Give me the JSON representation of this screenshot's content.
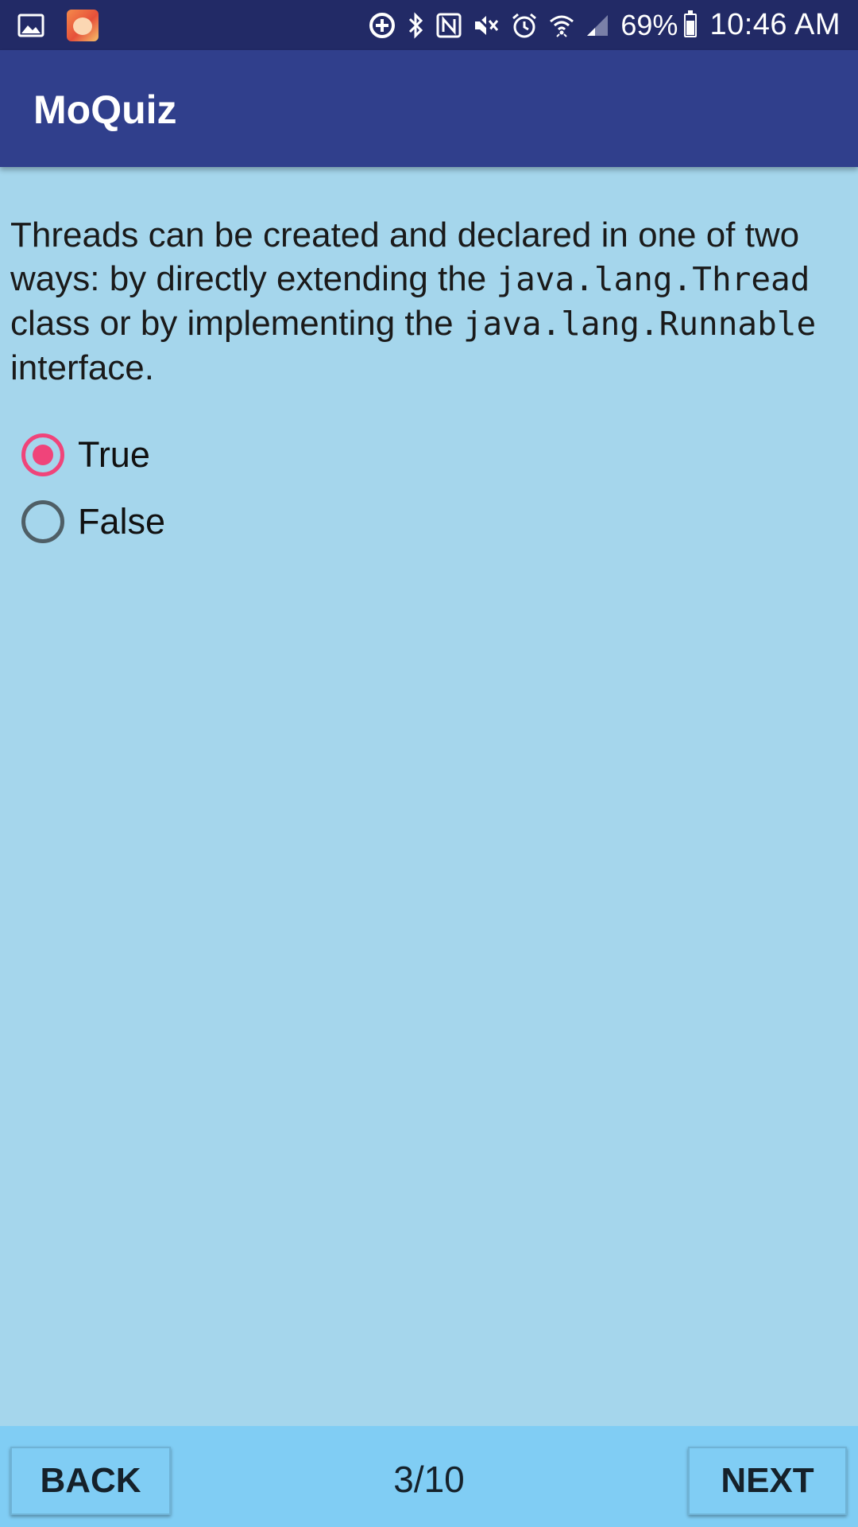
{
  "status_bar": {
    "battery": "69%",
    "time": "10:46 AM",
    "icons": [
      "gallery-icon",
      "app-thumbnail-icon",
      "data-saver-icon",
      "bluetooth-icon",
      "nfc-icon",
      "mute-icon",
      "alarm-icon",
      "wifi-icon",
      "signal-icon",
      "battery-icon"
    ]
  },
  "app_bar": {
    "title": "MoQuiz"
  },
  "question": {
    "part1": "Threads can be created and declared in one of two ways: by directly extending the ",
    "code1": "java.lang.Thread",
    "part2": " class or by implementing the ",
    "code2": "java.lang.Runnable",
    "part3": " interface."
  },
  "options": [
    {
      "label": "True",
      "selected": true
    },
    {
      "label": "False",
      "selected": false
    }
  ],
  "nav": {
    "back_label": "BACK",
    "next_label": "NEXT",
    "progress": "3/10"
  },
  "colors": {
    "status_bar": "#222A66",
    "app_bar": "#303F8C",
    "background": "#A5D6EC",
    "bottom_bar": "#80CDF4",
    "accent": "#F0447A"
  }
}
